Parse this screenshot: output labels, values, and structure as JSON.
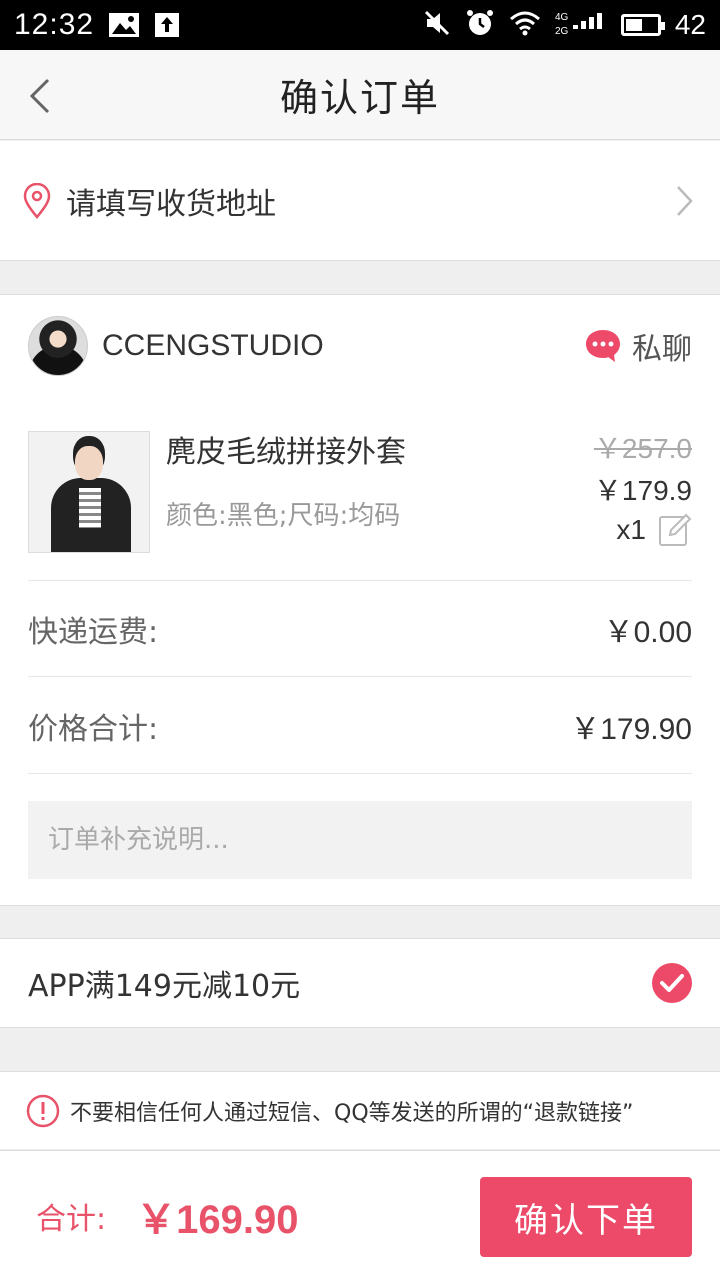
{
  "status_bar": {
    "time": "12:32",
    "battery": "42",
    "icons": [
      "image-icon",
      "upload-icon",
      "mute-icon",
      "alarm-icon",
      "wifi-icon",
      "signal-icon",
      "battery-icon"
    ]
  },
  "nav": {
    "title": "确认订单",
    "back_icon": "chevron-left-icon"
  },
  "address": {
    "placeholder_text": "请填写收货地址",
    "icon": "location-pin-icon"
  },
  "shop": {
    "name": "CCENGSTUDIO",
    "chat_label": "私聊"
  },
  "product": {
    "name": "麂皮毛绒拼接外套",
    "spec": "颜色:黑色;尺码:均码",
    "original_price": "￥257.0",
    "price": "￥179.9",
    "quantity": "x1"
  },
  "fees": {
    "shipping_label": "快递运费:",
    "shipping_value": "￥0.00",
    "total_label": "价格合计:",
    "total_value": "￥179.90"
  },
  "remark": {
    "placeholder": "订单补充说明..."
  },
  "promo": {
    "text": "APP满149元减10元",
    "checked": true
  },
  "warning": {
    "text": "不要相信任何人通过短信、QQ等发送的所谓的“退款链接”"
  },
  "footer": {
    "sum_label": "合计:",
    "sum_value": "￥169.90",
    "submit_label": "确认下单"
  },
  "colors": {
    "accent": "#ec4a68",
    "price_red": "#e8536a"
  }
}
